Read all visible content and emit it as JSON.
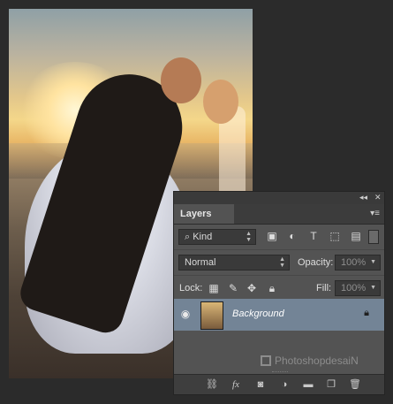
{
  "panel": {
    "tab": "Layers",
    "kind_filter": {
      "value": "Kind"
    },
    "blend_mode": {
      "value": "Normal"
    },
    "opacity": {
      "label": "Opacity:",
      "value": "100%"
    },
    "lock": {
      "label": "Lock:"
    },
    "fill": {
      "label": "Fill:",
      "value": "100%"
    },
    "layers": [
      {
        "name": "Background",
        "visible": true,
        "locked": true
      }
    ],
    "watermark": "PhotoshopdesaiN"
  },
  "icons": {
    "collapse": "double-arrow-icon",
    "close": "close-icon",
    "panel_menu": "panel-menu-icon",
    "search": "search-icon",
    "filter_pixel": "image-icon",
    "filter_adjust": "adjustment-icon",
    "filter_type": "type-icon",
    "filter_shape": "shape-icon",
    "filter_smart": "smart-object-icon",
    "lock_pixels": "checker-icon",
    "lock_brush": "brush-icon",
    "lock_move": "move-icon",
    "lock_all": "lock-icon",
    "link": "link-icon",
    "fx": "fx-icon",
    "mask": "mask-icon",
    "adjustment_layer": "half-circle-icon",
    "group": "folder-icon",
    "new_layer": "new-layer-icon",
    "delete": "trash-icon"
  }
}
